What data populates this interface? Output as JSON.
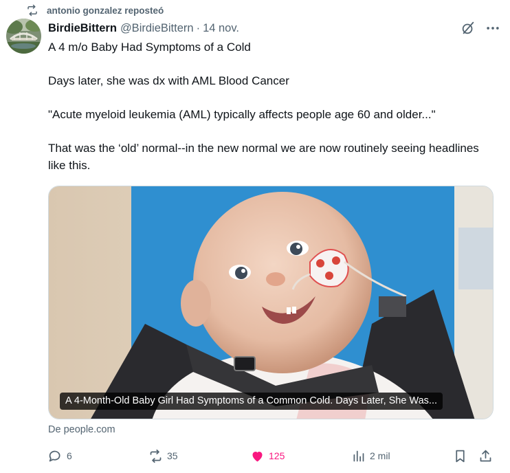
{
  "repost": {
    "text": "antonio gonzalez reposteó",
    "icon": "repost-icon"
  },
  "tweet": {
    "display_name": "BirdieBittern",
    "handle": "@BirdieBittern",
    "separator": "·",
    "date": "14 nov.",
    "text_lines": [
      "A 4 m/o Baby Had Symptoms of a Cold",
      "Days later, she was dx with AML Blood Cancer",
      "\"Acute myeloid leukemia (AML) typically affects people age 60 and older...\"",
      "That was the ‘old’ normal--in the new normal we are now routinely seeing headlines like this."
    ],
    "card": {
      "caption": "A 4-Month-Old Baby Girl Had Symptoms of a Common Cold. Days Later, She Was..."
    },
    "source": "De people.com"
  },
  "actions": {
    "replies": "6",
    "reposts": "35",
    "likes": "125",
    "views": "2 mil"
  },
  "colors": {
    "text": "#0f1419",
    "secondary": "#536471",
    "like": "#f91880",
    "border": "#cfd9de"
  }
}
